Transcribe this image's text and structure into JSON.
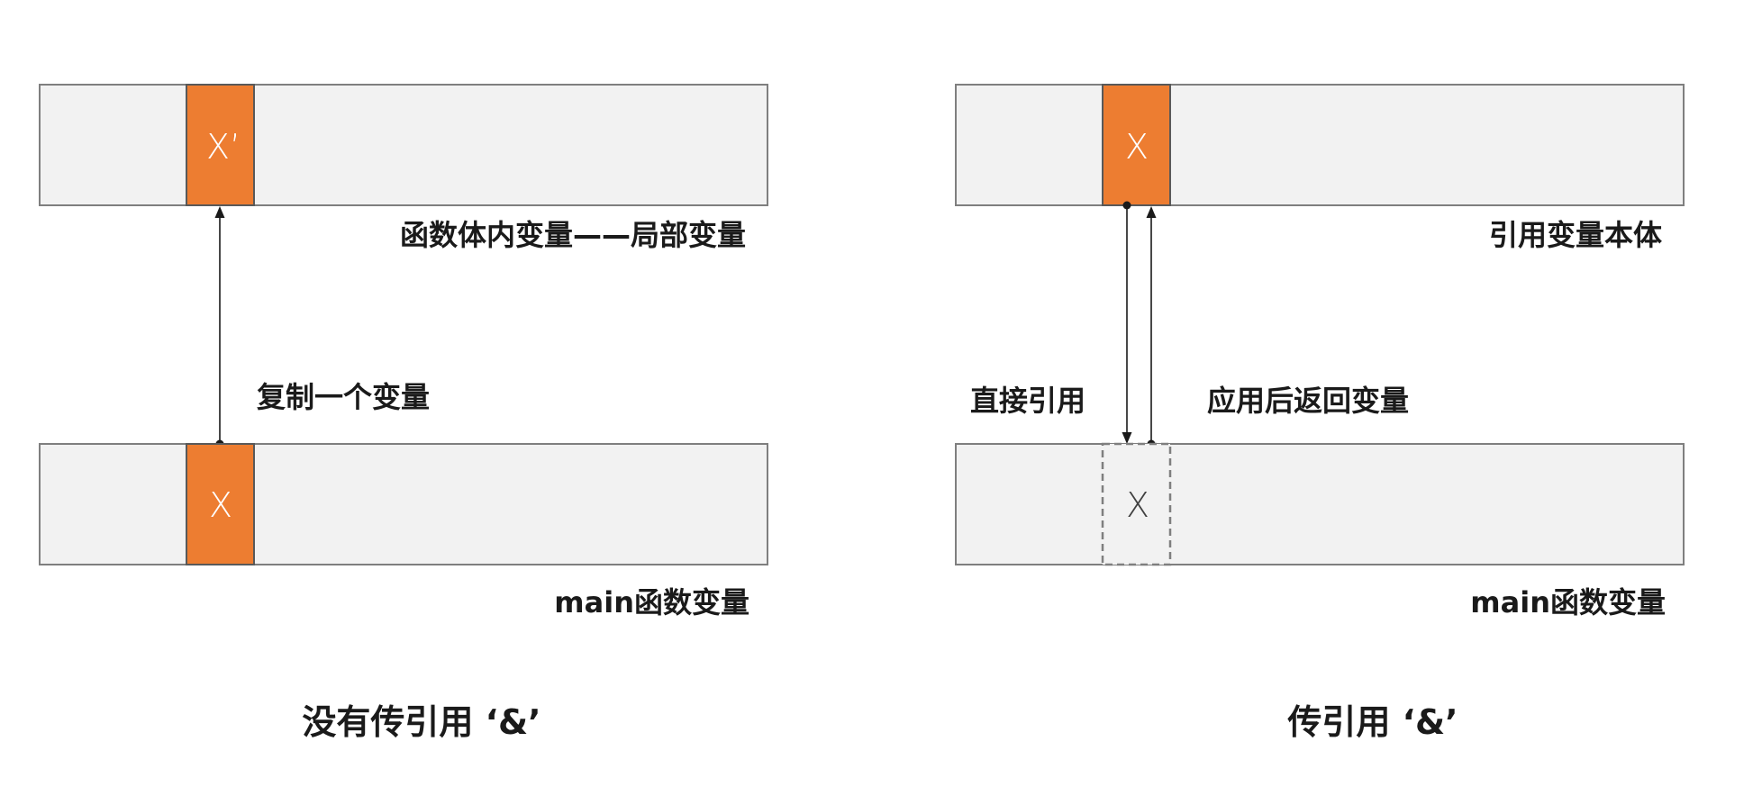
{
  "left_panel": {
    "top_cell_label": "X’",
    "top_caption": "函数体内变量——局部变量",
    "arrow_label": "复制一个变量",
    "bottom_cell_label": "X",
    "bottom_caption": "main函数变量",
    "title": "没有传引用 ‘&’"
  },
  "right_panel": {
    "top_cell_label": "X",
    "top_caption": "引用变量本体",
    "down_arrow_label": "直接引用",
    "up_arrow_label": "应用后返回变量",
    "bottom_cell_label": "X",
    "bottom_caption": "main函数变量",
    "title": "传引用 ‘&’"
  },
  "colors": {
    "highlight_cell": "#ed7d31",
    "bar_fill": "#f2f2f2",
    "bar_stroke": "#7f7f7f"
  }
}
